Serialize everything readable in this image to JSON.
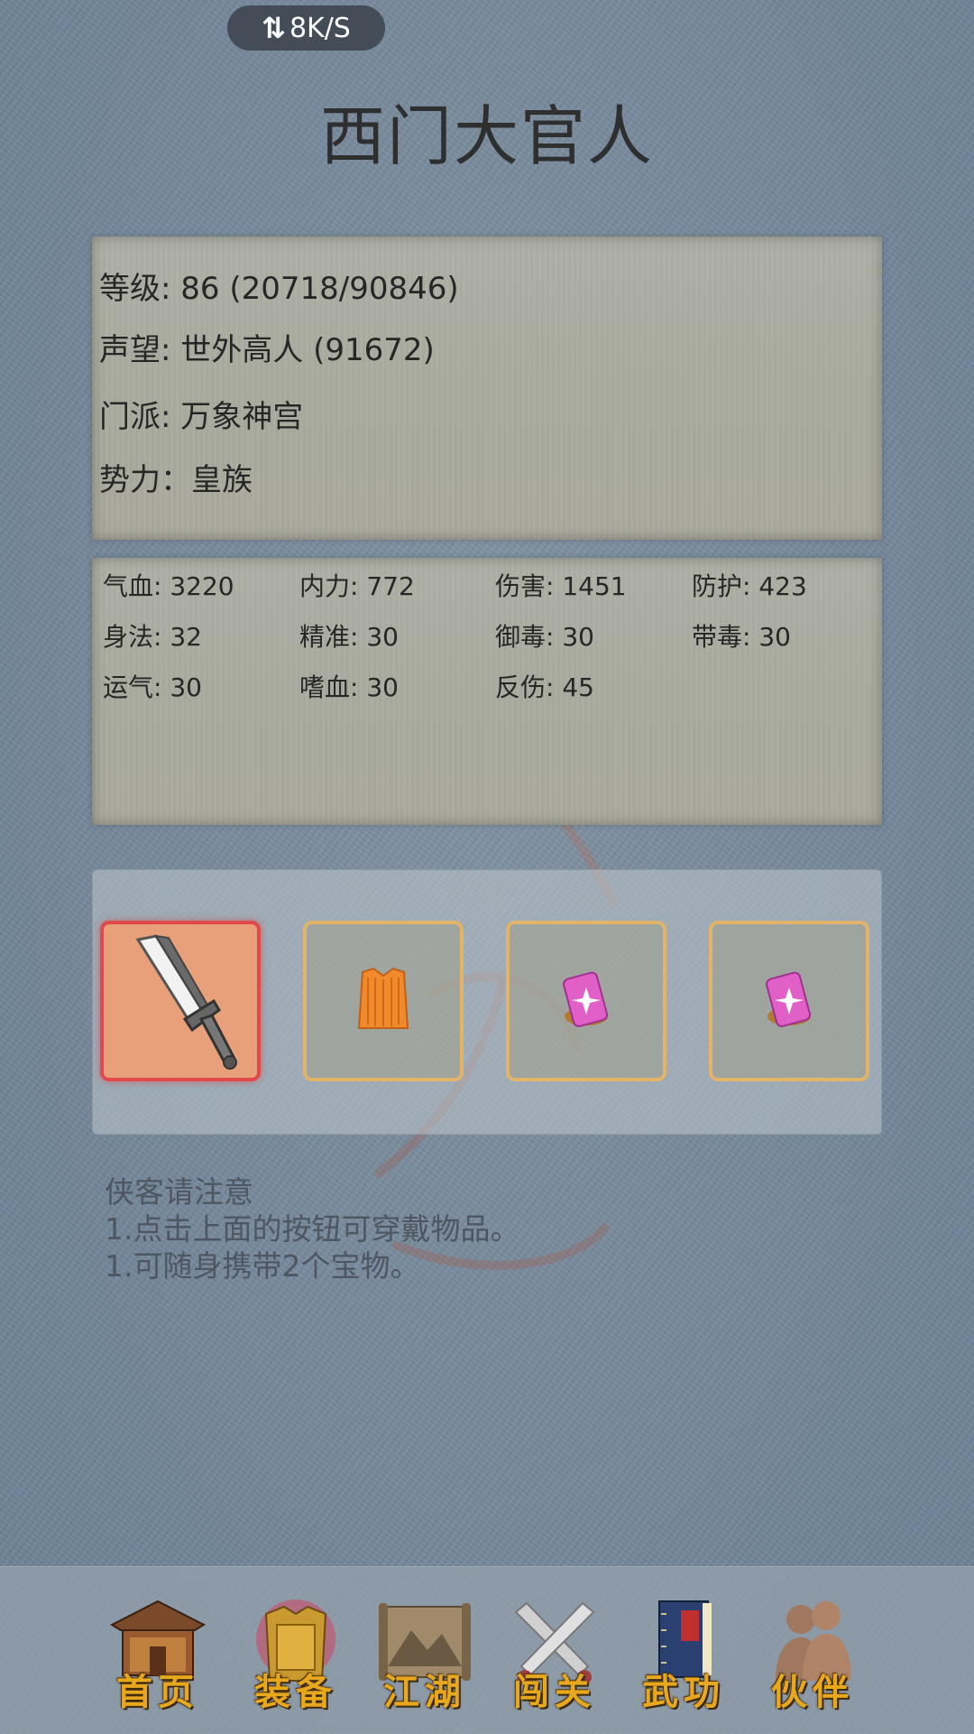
{
  "status_bar": {
    "speed_text": "8K/S"
  },
  "character": {
    "name": "西门大官人"
  },
  "info": {
    "level": "等级: 86 (20718/90846)",
    "reputation": "声望: 世外高人 (91672)",
    "sect": "门派: 万象神宫",
    "faction": "势力：皇族"
  },
  "stats": [
    "气血: 3220",
    "内力: 772",
    "伤害: 1451",
    "防护: 423",
    "身法: 32",
    "精准: 30",
    "御毒: 30",
    "带毒: 30",
    "运气: 30",
    "嗜血: 30",
    "反伤: 45"
  ],
  "equipment": {
    "slots": [
      {
        "icon": "broadsword-icon",
        "equipped": true
      },
      {
        "icon": "orange-robe-icon",
        "equipped": false
      },
      {
        "icon": "pink-treasure-icon",
        "equipped": false
      },
      {
        "icon": "pink-treasure-icon",
        "equipped": false
      }
    ],
    "colors": {
      "equipped_border": "#e04a4a",
      "slot_border": "#e2b46a"
    }
  },
  "notice": {
    "title": "侠客请注意",
    "line1": "1.点击上面的按钮可穿戴物品。",
    "line2": "1.可随身携带2个宝物。"
  },
  "nav": {
    "items": [
      {
        "label": "首页",
        "icon": "temple-icon"
      },
      {
        "label": "装备",
        "icon": "armor-icon"
      },
      {
        "label": "江湖",
        "icon": "scroll-map-icon"
      },
      {
        "label": "闯关",
        "icon": "crossed-swords-icon"
      },
      {
        "label": "武功",
        "icon": "book-icon"
      },
      {
        "label": "伙伴",
        "icon": "companions-icon"
      }
    ],
    "active": "装备",
    "label_color": "#e8a81e"
  }
}
